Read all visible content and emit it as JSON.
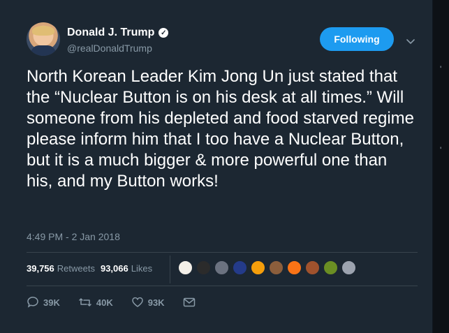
{
  "author": {
    "name": "Donald J. Trump",
    "handle": "@realDonaldTrump",
    "verified_icon": "verified-badge-icon"
  },
  "follow_button": {
    "label": "Following"
  },
  "tweet": {
    "text": "North Korean Leader Kim Jong Un just stated that the “Nuclear Button is on his desk at all times.” Will someone from his depleted and food starved regime please inform him that I too have a Nuclear Button, but it is a much bigger & more powerful one than his, and my Button works!",
    "timestamp": "4:49 PM - 2 Jan 2018"
  },
  "stats": {
    "retweets_count": "39,756",
    "retweets_label": "Retweets",
    "likes_count": "93,066",
    "likes_label": "Likes",
    "avatar_colors": [
      "#f3efe8",
      "#2b2b2b",
      "#6b7280",
      "#243b8a",
      "#f59e0b",
      "#8b5e3c",
      "#f97316",
      "#a0522d",
      "#6b8e23",
      "#9ca3af"
    ]
  },
  "actions": {
    "reply_count": "39K",
    "retweet_count": "40K",
    "like_count": "93K"
  },
  "colors": {
    "accent": "#1d9bf0",
    "card_bg": "#1c2732",
    "muted_text": "#8899a6"
  }
}
